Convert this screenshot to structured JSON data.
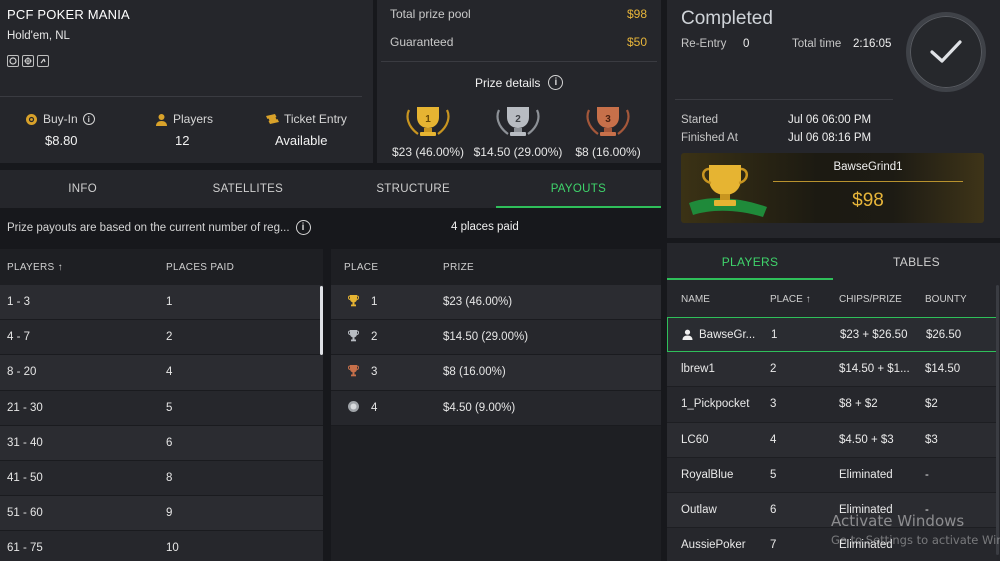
{
  "tournament": {
    "title": "PCF POKER MANIA",
    "game": "Hold'em, NL",
    "buyin_label": "Buy-In",
    "buyin_value": "$8.80",
    "players_label": "Players",
    "players_value": "12",
    "ticket_label": "Ticket Entry",
    "ticket_value": "Available"
  },
  "pool": {
    "total_label": "Total prize pool",
    "total_value": "$98",
    "guaranteed_label": "Guaranteed",
    "guaranteed_value": "$50",
    "details_label": "Prize details",
    "trophies": [
      {
        "place": "1",
        "value": "$23 (46.00%)",
        "color": "#e6b432"
      },
      {
        "place": "2",
        "value": "$14.50 (29.00%)",
        "color": "#b8bcc2"
      },
      {
        "place": "3",
        "value": "$8 (16.00%)",
        "color": "#c7704a"
      }
    ]
  },
  "status": {
    "title": "Completed",
    "reentry_label": "Re-Entry",
    "reentry_value": "0",
    "total_time_label": "Total time",
    "total_time_value": "2:16:05",
    "started_label": "Started",
    "started_value": "Jul 06 06:00 PM",
    "finished_label": "Finished At",
    "finished_value": "Jul 06 08:16 PM",
    "winner_name": "BawseGrind1",
    "winner_prize": "$98"
  },
  "tabs": [
    "INFO",
    "SATELLITES",
    "STRUCTURE",
    "PAYOUTS"
  ],
  "payouts": {
    "note": "Prize payouts are based on the current number of reg...",
    "places_paid": "4 places paid",
    "left_headers": [
      "PLAYERS ↑",
      "PLACES PAID"
    ],
    "left_rows": [
      [
        "1 - 3",
        "1"
      ],
      [
        "4 - 7",
        "2"
      ],
      [
        "8 - 20",
        "4"
      ],
      [
        "21 - 30",
        "5"
      ],
      [
        "31 - 40",
        "6"
      ],
      [
        "41 - 50",
        "8"
      ],
      [
        "51 - 60",
        "9"
      ],
      [
        "61 - 75",
        "10"
      ]
    ],
    "right_headers": [
      "PLACE",
      "PRIZE"
    ],
    "right_rows": [
      {
        "place": "1",
        "prize": "$23 (46.00%)",
        "icon": "gold-trophy-icon"
      },
      {
        "place": "2",
        "prize": "$14.50 (29.00%)",
        "icon": "silver-trophy-icon"
      },
      {
        "place": "3",
        "prize": "$8 (16.00%)",
        "icon": "bronze-trophy-icon"
      },
      {
        "place": "4",
        "prize": "$4.50 (9.00%)",
        "icon": "medal-icon"
      }
    ]
  },
  "players_panel": {
    "tabs": [
      "PLAYERS",
      "TABLES"
    ],
    "headers": [
      "NAME",
      "PLACE ↑",
      "CHIPS/PRIZE",
      "BOUNTY"
    ],
    "rows": [
      {
        "name": "BawseGr...",
        "place": "1",
        "chips": "$23 + $26.50",
        "bounty": "$26.50"
      },
      {
        "name": "lbrew1",
        "place": "2",
        "chips": "$14.50 + $1...",
        "bounty": "$14.50"
      },
      {
        "name": "1_Pickpocket",
        "place": "3",
        "chips": "$8 + $2",
        "bounty": "$2"
      },
      {
        "name": "LC60",
        "place": "4",
        "chips": "$4.50 + $3",
        "bounty": "$3"
      },
      {
        "name": "RoyalBlue",
        "place": "5",
        "chips": "Eliminated",
        "bounty": "-"
      },
      {
        "name": "Outlaw",
        "place": "6",
        "chips": "Eliminated",
        "bounty": "-"
      },
      {
        "name": "AussiePoker",
        "place": "7",
        "chips": "Eliminated",
        "bounty": ""
      }
    ]
  },
  "watermark": {
    "line1": "Activate Windows",
    "line2": "Go to Settings to activate Windows."
  }
}
